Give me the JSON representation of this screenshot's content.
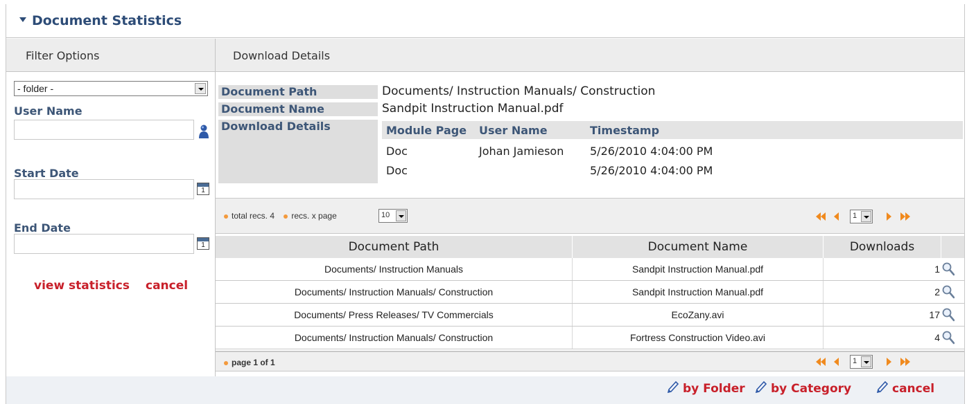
{
  "panel": {
    "title": "Document Statistics"
  },
  "filter": {
    "header": "Filter Options",
    "folder_select": "- folder -",
    "user_name_label": "User Name",
    "start_date_label": "Start Date",
    "end_date_label": "End Date",
    "calendar_day": "1",
    "view_statistics": "view statistics",
    "cancel": "cancel"
  },
  "details": {
    "header": "Download Details",
    "document_path_label": "Document Path",
    "document_path": "Documents/ Instruction Manuals/ Construction",
    "document_name_label": "Document Name",
    "document_name": "Sandpit Instruction Manual.pdf",
    "download_details_label": "Download Details",
    "columns": [
      "Module Page",
      "User Name",
      "Timestamp"
    ],
    "rows": [
      [
        "Doc",
        "Johan Jamieson",
        "5/26/2010 4:04:00 PM"
      ],
      [
        "Doc",
        "",
        "5/26/2010 4:04:00 PM"
      ]
    ]
  },
  "pager_top": {
    "total_recs": "total recs. 4",
    "recs_per_page_label": "recs. x page",
    "recs_per_page": "10",
    "page": "1"
  },
  "grid": {
    "columns": [
      "Document Path",
      "Document Name",
      "Downloads"
    ],
    "rows": [
      [
        "Documents/ Instruction Manuals",
        "Sandpit Instruction Manual.pdf",
        "1"
      ],
      [
        "Documents/ Instruction Manuals/ Construction",
        "Sandpit Instruction Manual.pdf",
        "2"
      ],
      [
        "Documents/ Press Releases/ TV Commercials",
        "EcoZany.avi",
        "17"
      ],
      [
        "Documents/ Instruction Manuals/ Construction",
        "Fortress Construction Video.avi",
        "4"
      ]
    ]
  },
  "pager_bottom": {
    "page_info": "page 1 of 1",
    "page": "1"
  },
  "footer": {
    "by_folder": "by Folder",
    "by_category": "by Category",
    "cancel": "cancel"
  },
  "icons": {
    "user": "user-picker-icon",
    "calendar": "calendar-icon",
    "magnifier": "magnifier-icon",
    "pencil": "pencil-icon",
    "pager": [
      "first-page-icon",
      "previous-page-icon",
      "next-page-icon",
      "last-page-icon"
    ]
  },
  "colors": {
    "title_blue": "#2d4c77",
    "label_blue": "#3d5677",
    "link_red": "#c8202a",
    "pager_orange": "#f39a3d"
  }
}
